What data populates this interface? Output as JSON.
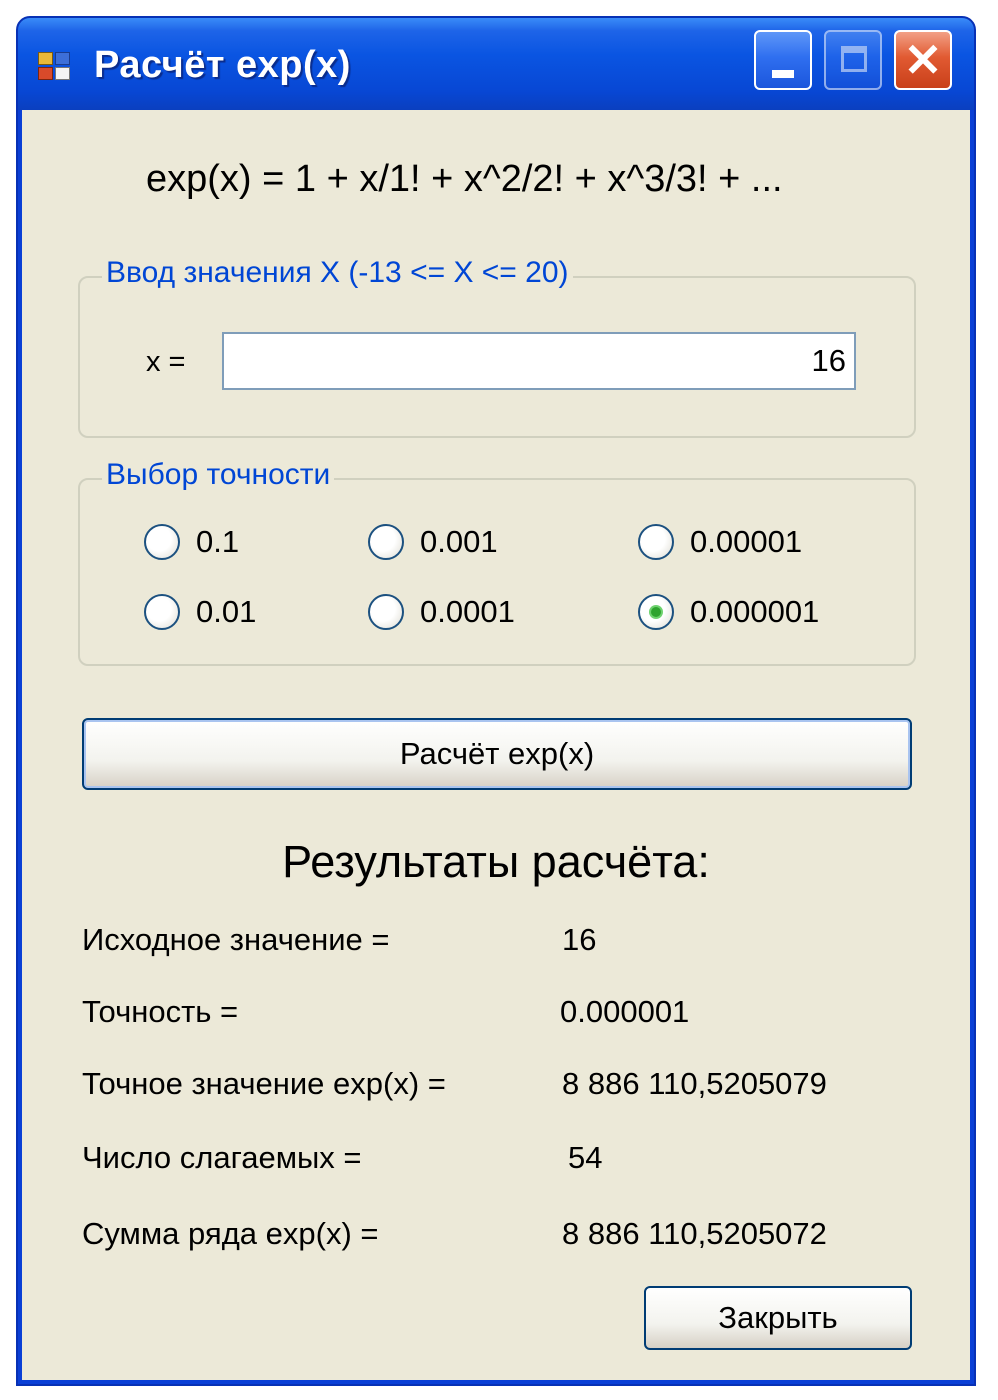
{
  "window": {
    "title": "Расчёт exp(x)",
    "controls": {
      "minimize": "minimize",
      "maximize": "maximize",
      "close": "close"
    }
  },
  "formula": "exp(x) = 1 + x/1! + x^2/2! + x^3/3! + ...",
  "input_group": {
    "legend": "Ввод значения X  (-13 <= X <= 20)",
    "label": "x =",
    "value": "16"
  },
  "precision_group": {
    "legend": "Выбор точности",
    "options": [
      {
        "label": "0.1",
        "selected": false
      },
      {
        "label": "0.01",
        "selected": false
      },
      {
        "label": "0.001",
        "selected": false
      },
      {
        "label": "0.0001",
        "selected": false
      },
      {
        "label": "0.00001",
        "selected": false
      },
      {
        "label": "0.000001",
        "selected": true
      }
    ]
  },
  "calc_button": "Расчёт exp(x)",
  "results": {
    "title": "Результаты расчёта:",
    "rows": [
      {
        "label": "Исходное значение =",
        "value": "16"
      },
      {
        "label": "Точность =",
        "value": "0.000001"
      },
      {
        "label": "Точное значение exp(x) =",
        "value": "8 886 110,5205079"
      },
      {
        "label": "Число слагаемых =",
        "value": "54"
      },
      {
        "label": "Сумма ряда exp(x) =",
        "value": "8 886 110,5205072"
      }
    ]
  },
  "close_button": "Закрыть",
  "icons": {
    "app": "app-icon",
    "minimize": "minimize-icon",
    "maximize": "maximize-icon",
    "close": "close-icon"
  },
  "colors": {
    "titlebar": "#0a55e2",
    "client": "#ece9d8",
    "group_legend": "#0046d5",
    "radio_selected": "#2ea32e"
  }
}
